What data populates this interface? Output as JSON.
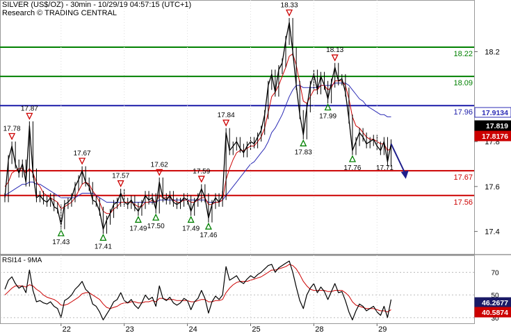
{
  "header": {
    "title": "SILVER (US$/OZ) - 30min - 10/29/19 04:57:15 (UTC+1)",
    "source": "Research © TRADING CENTRAL"
  },
  "colors": {
    "price": "#000000",
    "ma_fast": "#cc0000",
    "ma_slow": "#2b2bb5",
    "support": "#cc0000",
    "resistance": "#008000",
    "pivot": "#1a1aa8",
    "up_marker": "#008000",
    "down_marker": "#cc0000",
    "arrow": "#1f1f8c",
    "last_price_bg": "#000000",
    "rsi_line": "#000000",
    "rsi_ma": "#cc0000"
  },
  "chart_data": [
    {
      "type": "line",
      "panel": "price",
      "y_ticks": [
        17.4,
        17.6,
        17.8,
        18.2
      ],
      "ylim": [
        17.3,
        18.43
      ],
      "x_ticks": [
        "22",
        "23",
        "24",
        "25",
        "28",
        "29"
      ],
      "x_tick_index": [
        16,
        34,
        52,
        70,
        88,
        106
      ],
      "levels": [
        {
          "label": "18.22",
          "value": 18.22,
          "role": "resistance"
        },
        {
          "label": "18.09",
          "value": 18.09,
          "role": "resistance"
        },
        {
          "label": "17.96",
          "value": 17.96,
          "role": "pivot"
        },
        {
          "label": "17.67",
          "value": 17.67,
          "role": "support"
        },
        {
          "label": "17.56",
          "value": 17.56,
          "role": "support"
        }
      ],
      "price_tags": [
        {
          "label": "17.9134",
          "value": 17.9134,
          "style": "ma_slow"
        },
        {
          "label": "17.819",
          "value": 17.819,
          "style": "last"
        },
        {
          "label": "17.8176",
          "value": 17.8176,
          "style": "ma_fast"
        }
      ],
      "markers": [
        {
          "label": "17.78",
          "i": 2,
          "value": 17.78,
          "dir": "down"
        },
        {
          "label": "17.87",
          "i": 7,
          "value": 17.87,
          "dir": "down"
        },
        {
          "label": "17.43",
          "i": 16,
          "value": 17.43,
          "dir": "up"
        },
        {
          "label": "17.67",
          "i": 22,
          "value": 17.67,
          "dir": "down"
        },
        {
          "label": "17.41",
          "i": 28,
          "value": 17.41,
          "dir": "up"
        },
        {
          "label": "17.57",
          "i": 33,
          "value": 17.57,
          "dir": "down"
        },
        {
          "label": "17.49",
          "i": 38,
          "value": 17.49,
          "dir": "up"
        },
        {
          "label": "17.62",
          "i": 44,
          "value": 17.62,
          "dir": "down"
        },
        {
          "label": "17.50",
          "i": 43,
          "value": 17.5,
          "dir": "up"
        },
        {
          "label": "17.49",
          "i": 53,
          "value": 17.49,
          "dir": "up"
        },
        {
          "label": "17.59",
          "i": 56,
          "value": 17.59,
          "dir": "down"
        },
        {
          "label": "17.46",
          "i": 58,
          "value": 17.46,
          "dir": "up"
        },
        {
          "label": "17.84",
          "i": 63,
          "value": 17.84,
          "dir": "down"
        },
        {
          "label": "18.33",
          "i": 81,
          "value": 18.33,
          "dir": "down"
        },
        {
          "label": "17.83",
          "i": 85,
          "value": 17.83,
          "dir": "up"
        },
        {
          "label": "18.13",
          "i": 94,
          "value": 18.13,
          "dir": "down"
        },
        {
          "label": "17.99",
          "i": 92,
          "value": 17.99,
          "dir": "up"
        },
        {
          "label": "17.76",
          "i": 99,
          "value": 17.76,
          "dir": "up"
        },
        {
          "label": "17.71",
          "i": 109,
          "value": 17.71,
          "dir": "none"
        }
      ],
      "projection": {
        "from_i": 110,
        "from_value": 17.79,
        "to_i": 114,
        "to_value": 17.64
      },
      "series": [
        {
          "role": "price",
          "values": [
            17.55,
            17.72,
            17.78,
            17.7,
            17.66,
            17.7,
            17.62,
            17.87,
            17.66,
            17.55,
            17.56,
            17.54,
            17.53,
            17.55,
            17.51,
            17.5,
            17.43,
            17.52,
            17.53,
            17.55,
            17.6,
            17.63,
            17.67,
            17.62,
            17.6,
            17.54,
            17.53,
            17.49,
            17.41,
            17.45,
            17.48,
            17.52,
            17.53,
            17.57,
            17.53,
            17.52,
            17.54,
            17.51,
            17.49,
            17.52,
            17.56,
            17.54,
            17.55,
            17.5,
            17.62,
            17.55,
            17.54,
            17.56,
            17.53,
            17.52,
            17.53,
            17.55,
            17.54,
            17.49,
            17.53,
            17.55,
            17.59,
            17.55,
            17.46,
            17.52,
            17.55,
            17.53,
            17.56,
            17.84,
            17.76,
            17.78,
            17.8,
            17.77,
            17.75,
            17.78,
            17.8,
            17.79,
            17.82,
            17.85,
            17.92,
            18.05,
            18.1,
            18.02,
            18.12,
            18.15,
            18.25,
            18.33,
            18.2,
            18.05,
            17.92,
            17.83,
            17.95,
            18.05,
            18.1,
            18.03,
            18.09,
            18.05,
            17.99,
            18.06,
            18.13,
            18.07,
            18.08,
            18.02,
            17.9,
            17.76,
            17.8,
            17.84,
            17.82,
            17.79,
            17.8,
            17.81,
            17.78,
            17.76,
            17.8,
            17.71,
            17.79
          ]
        },
        {
          "role": "ma_fast",
          "values": [
            17.6,
            17.62,
            17.66,
            17.67,
            17.68,
            17.68,
            17.66,
            17.68,
            17.66,
            17.62,
            17.6,
            17.57,
            17.56,
            17.55,
            17.54,
            17.53,
            17.5,
            17.51,
            17.52,
            17.53,
            17.55,
            17.58,
            17.61,
            17.62,
            17.61,
            17.58,
            17.56,
            17.53,
            17.49,
            17.48,
            17.48,
            17.5,
            17.51,
            17.53,
            17.53,
            17.53,
            17.53,
            17.52,
            17.51,
            17.51,
            17.53,
            17.53,
            17.54,
            17.53,
            17.56,
            17.55,
            17.55,
            17.55,
            17.54,
            17.53,
            17.53,
            17.54,
            17.54,
            17.53,
            17.53,
            17.54,
            17.55,
            17.55,
            17.52,
            17.52,
            17.53,
            17.53,
            17.54,
            17.63,
            17.68,
            17.72,
            17.75,
            17.76,
            17.76,
            17.77,
            17.78,
            17.78,
            17.8,
            17.82,
            17.86,
            17.93,
            18.0,
            18.02,
            18.05,
            18.09,
            18.13,
            18.18,
            18.19,
            18.14,
            18.06,
            17.98,
            17.97,
            18.0,
            18.03,
            18.03,
            18.05,
            18.05,
            18.03,
            18.04,
            18.07,
            18.07,
            18.07,
            18.05,
            17.99,
            17.91,
            17.87,
            17.86,
            17.84,
            17.82,
            17.81,
            17.81,
            17.8,
            17.79,
            17.79,
            17.76,
            17.77
          ]
        },
        {
          "role": "ma_slow",
          "values": [
            17.56,
            17.57,
            17.58,
            17.59,
            17.6,
            17.61,
            17.61,
            17.62,
            17.62,
            17.61,
            17.61,
            17.6,
            17.59,
            17.58,
            17.57,
            17.56,
            17.55,
            17.55,
            17.55,
            17.55,
            17.55,
            17.56,
            17.57,
            17.57,
            17.57,
            17.57,
            17.56,
            17.55,
            17.54,
            17.53,
            17.53,
            17.53,
            17.53,
            17.53,
            17.53,
            17.53,
            17.53,
            17.53,
            17.53,
            17.53,
            17.53,
            17.53,
            17.53,
            17.53,
            17.54,
            17.54,
            17.54,
            17.54,
            17.54,
            17.54,
            17.54,
            17.54,
            17.54,
            17.54,
            17.54,
            17.54,
            17.54,
            17.54,
            17.53,
            17.53,
            17.53,
            17.53,
            17.54,
            17.56,
            17.58,
            17.6,
            17.62,
            17.64,
            17.66,
            17.68,
            17.7,
            17.71,
            17.73,
            17.75,
            17.77,
            17.8,
            17.84,
            17.86,
            17.89,
            17.92,
            17.96,
            18.0,
            18.03,
            18.05,
            18.05,
            18.04,
            18.04,
            18.04,
            18.04,
            18.04,
            18.05,
            18.05,
            18.05,
            18.05,
            18.06,
            18.06,
            18.06,
            18.06,
            18.05,
            18.03,
            18.01,
            17.99,
            17.98,
            17.96,
            17.95,
            17.94,
            17.93,
            17.92,
            17.92,
            17.91,
            17.91
          ]
        }
      ]
    },
    {
      "type": "line",
      "panel": "rsi",
      "title": "RSI14 - 9MA",
      "y_ticks": [
        30,
        50,
        70
      ],
      "ylim": [
        25,
        85
      ],
      "price_tags": [
        {
          "label": "46.2677",
          "value": 46.2677,
          "style": "rsi"
        },
        {
          "label": "40.5874",
          "value": 40.5874,
          "style": "rsi_ma"
        }
      ],
      "series": [
        {
          "role": "rsi",
          "values": [
            55,
            63,
            66,
            60,
            56,
            58,
            52,
            72,
            54,
            44,
            45,
            43,
            42,
            44,
            40,
            38,
            30,
            45,
            47,
            50,
            55,
            58,
            62,
            55,
            52,
            42,
            40,
            35,
            28,
            33,
            38,
            44,
            46,
            52,
            45,
            43,
            46,
            41,
            38,
            43,
            50,
            46,
            48,
            40,
            58,
            47,
            45,
            48,
            43,
            41,
            43,
            47,
            45,
            37,
            44,
            47,
            54,
            47,
            34,
            44,
            49,
            46,
            50,
            75,
            63,
            65,
            67,
            62,
            60,
            64,
            67,
            65,
            68,
            70,
            73,
            76,
            77,
            70,
            74,
            76,
            78,
            80,
            70,
            57,
            45,
            38,
            50,
            56,
            60,
            52,
            57,
            53,
            46,
            53,
            60,
            52,
            53,
            45,
            35,
            28,
            36,
            42,
            40,
            36,
            38,
            40,
            35,
            32,
            40,
            30,
            46
          ]
        },
        {
          "role": "rsi_ma",
          "values": [
            50,
            53,
            56,
            58,
            58,
            58,
            57,
            59,
            58,
            55,
            53,
            50,
            48,
            47,
            46,
            44,
            41,
            41,
            42,
            44,
            46,
            48,
            51,
            52,
            52,
            50,
            48,
            46,
            42,
            39,
            38,
            39,
            40,
            42,
            43,
            43,
            44,
            44,
            43,
            43,
            44,
            44,
            45,
            44,
            47,
            47,
            46,
            46,
            46,
            45,
            45,
            45,
            45,
            44,
            44,
            45,
            46,
            46,
            44,
            44,
            45,
            45,
            46,
            52,
            56,
            59,
            61,
            62,
            62,
            62,
            63,
            64,
            65,
            66,
            68,
            70,
            72,
            72,
            73,
            74,
            75,
            77,
            76,
            73,
            68,
            62,
            58,
            55,
            54,
            54,
            54,
            54,
            53,
            53,
            54,
            54,
            54,
            52,
            49,
            44,
            41,
            40,
            39,
            38,
            38,
            38,
            37,
            36,
            36,
            35,
            37
          ]
        }
      ]
    }
  ]
}
